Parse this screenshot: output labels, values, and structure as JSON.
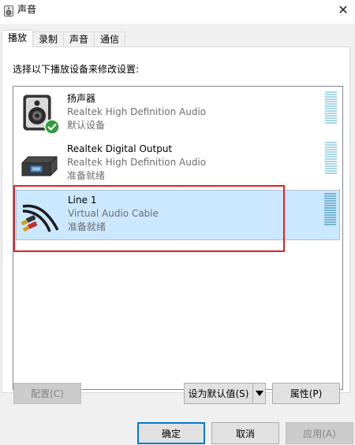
{
  "window": {
    "title": "声音"
  },
  "tabs": [
    {
      "label": "播放",
      "active": true
    },
    {
      "label": "录制",
      "active": false
    },
    {
      "label": "声音",
      "active": false
    },
    {
      "label": "通信",
      "active": false
    }
  ],
  "instruction": "选择以下播放设备来修改设置:",
  "devices": [
    {
      "name": "扬声器",
      "driver": "Realtek High Definition Audio",
      "status": "默认设备",
      "icon": "speaker-icon",
      "default": true,
      "selected": false
    },
    {
      "name": "Realtek Digital Output",
      "driver": "Realtek High Definition Audio",
      "status": "准备就绪",
      "icon": "digital-output-icon",
      "default": false,
      "selected": false
    },
    {
      "name": "Line 1",
      "driver": "Virtual Audio Cable",
      "status": "准备就绪",
      "icon": "audio-cable-icon",
      "default": false,
      "selected": true
    }
  ],
  "buttons": {
    "configure": "配置(C)",
    "set_default": "设为默认值(S)",
    "properties": "属性(P)",
    "ok": "确定",
    "cancel": "取消",
    "apply": "应用(A)"
  },
  "colors": {
    "selection": "#cce8ff",
    "annotation_red": "#e81e24",
    "default_check": "#2e9b3e",
    "focus_blue": "#0078d7"
  }
}
